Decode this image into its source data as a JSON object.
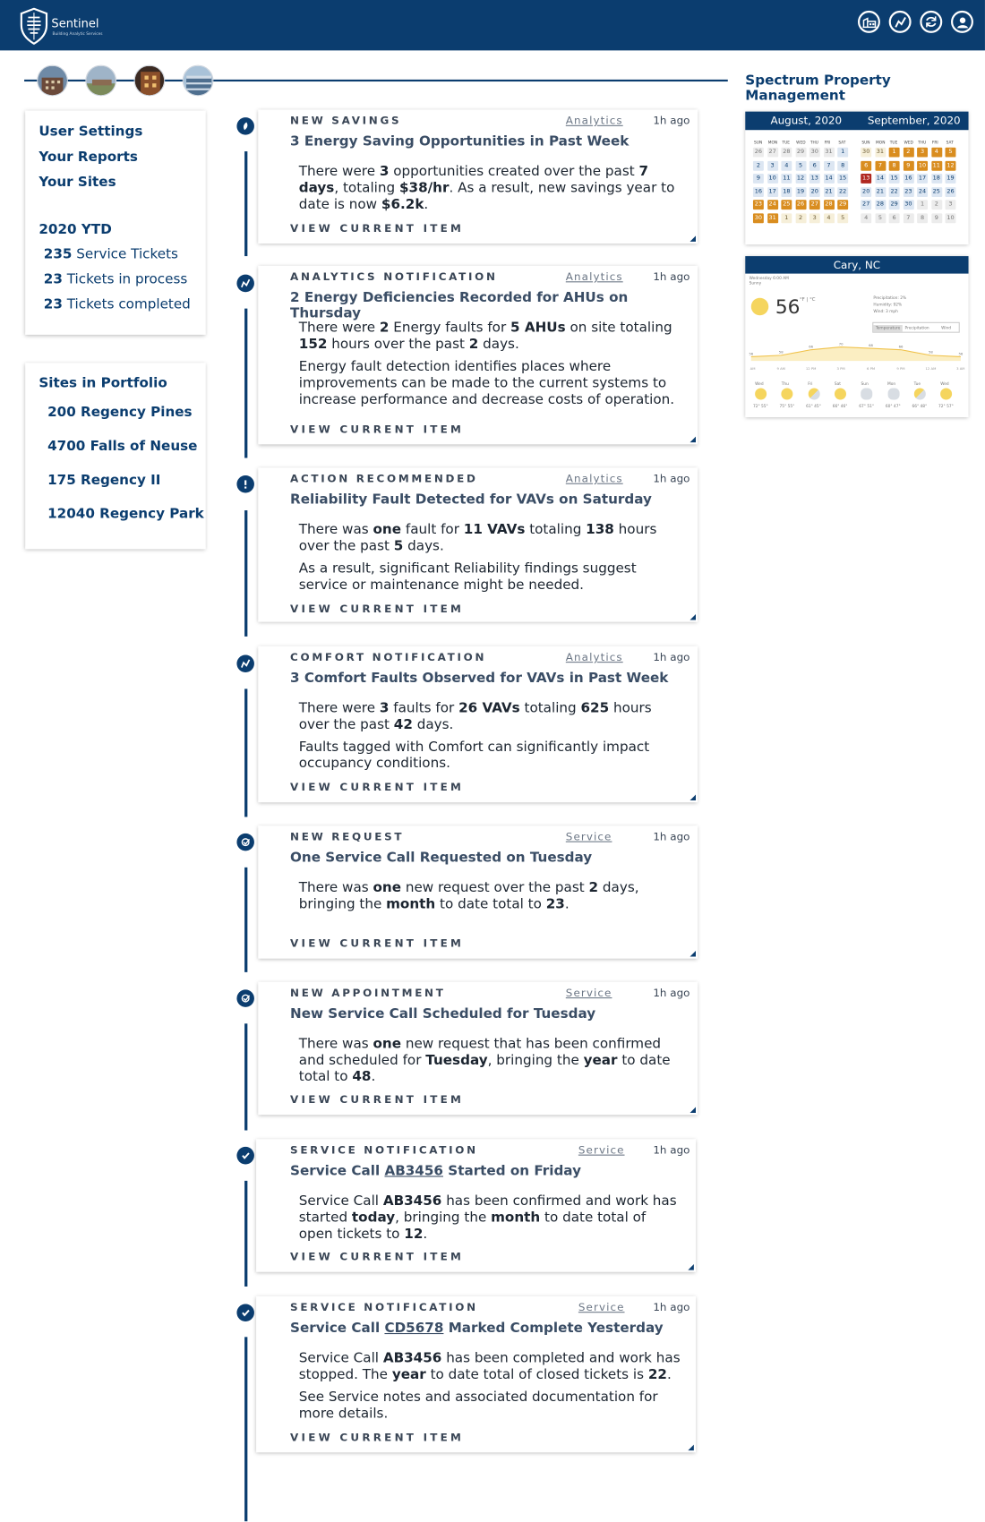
{
  "app": {
    "brand": "Sentinel",
    "tagline": "Building Analytic Services",
    "company": "Spectrum Property Management"
  },
  "topbar_icons": [
    "building-icon",
    "energy-icon",
    "refresh-icon",
    "user-icon"
  ],
  "colors": {
    "primary": "#0b3d6f",
    "accent": "#d98d1f",
    "today": "#b0271f"
  },
  "sidebar": {
    "links": [
      "User Settings",
      "Your Reports",
      "Your Sites"
    ],
    "ytd_title": "2020 YTD",
    "stats": [
      {
        "value": "235",
        "label": "Service Tickets"
      },
      {
        "value": "23",
        "label": "Tickets in process"
      },
      {
        "value": "23",
        "label": "Tickets completed"
      }
    ],
    "portfolio_title": "Sites in Portfolio",
    "sites": [
      "200 Regency Pines",
      "4700 Falls of Neuse",
      "175 Regency II",
      "12040 Regency Park"
    ]
  },
  "feed": [
    {
      "category": "NEW SAVINGS",
      "source": "Analytics",
      "time": "1h ago",
      "title": "3 Energy Saving Opportunities in Past Week",
      "icon": "savings-icon",
      "view": "VIEW CURRENT ITEM"
    },
    {
      "category": "ANALYTICS NOTIFICATION",
      "source": "Analytics",
      "time": "1h ago",
      "title": "2 Energy Deficiencies Recorded for AHUs on Thursday",
      "icon": "analytics-icon",
      "view": "VIEW CURRENT ITEM"
    },
    {
      "category": "ACTION RECOMMENDED",
      "source": "Analytics",
      "time": "1h ago",
      "title": "Reliability Fault Detected for VAVs on Saturday",
      "icon": "alert-icon",
      "view": "VIEW CURRENT ITEM"
    },
    {
      "category": "COMFORT NOTIFICATION",
      "source": "Analytics",
      "time": "1h ago",
      "title": "3 Comfort Faults Observed for VAVs in Past Week",
      "icon": "analytics-icon",
      "view": "VIEW CURRENT ITEM"
    },
    {
      "category": "NEW REQUEST",
      "source": "Service",
      "time": "1h ago",
      "title": "One Service Call Requested on Tuesday",
      "icon": "request-icon",
      "view": "VIEW CURRENT ITEM"
    },
    {
      "category": "NEW APPOINTMENT",
      "source": "Service",
      "time": "1h ago",
      "title": "New Service Call Scheduled for Tuesday",
      "icon": "request-icon",
      "view": "VIEW CURRENT ITEM"
    },
    {
      "category": "SERVICE NOTIFICATION",
      "source": "Service",
      "time": "1h ago",
      "title_pre": "Service Call",
      "title_code": "AB3456",
      "title_post": "Started on Friday",
      "icon": "check-icon",
      "view": "VIEW CURRENT ITEM"
    },
    {
      "category": "SERVICE NOTIFICATION",
      "source": "Service",
      "time": "1h ago",
      "title_pre": "Service Call",
      "title_code": "CD5678",
      "title_post": "Marked Complete Yesterday",
      "icon": "check-icon",
      "view": "VIEW CURRENT ITEM"
    }
  ],
  "feed_body": {
    "f0_a": "There were ",
    "f0_b": "3",
    "f0_c": " opportunities created over the past ",
    "f0_d": "7 days",
    "f0_e": ", totaling ",
    "f0_f": "$38/hr",
    "f0_g": ". As a result, new savings year to date is now ",
    "f0_h": "$6.2k",
    "f0_i": ".",
    "f1_a": "There were ",
    "f1_b": "2",
    "f1_c": " Energy faults for ",
    "f1_d": "5 AHUs",
    "f1_e": " on site totaling ",
    "f1_f": "152",
    "f1_g": " hours over the past ",
    "f1_h": "2",
    "f1_i": " days.",
    "f1_p2": "Energy fault detection identifies places where improvements can be made to the current systems to increase performance and decrease costs of operation.",
    "f2_a": "There was ",
    "f2_b": "one",
    "f2_c": " fault for ",
    "f2_d": "11 VAVs",
    "f2_e": " totaling ",
    "f2_f": "138",
    "f2_g": " hours over the past ",
    "f2_h": "5",
    "f2_i": " days.",
    "f2_p2": "As a result, significant Reliability findings suggest service or maintenance might be needed.",
    "f3_a": "There were ",
    "f3_b": "3",
    "f3_c": " faults for ",
    "f3_d": "26 VAVs",
    "f3_e": " totaling ",
    "f3_f": "625",
    "f3_g": " hours over the past ",
    "f3_h": "42",
    "f3_i": " days.",
    "f3_p2": "Faults tagged with Comfort can significantly impact occupancy conditions.",
    "f4_a": "There was ",
    "f4_b": "one",
    "f4_c": " new request over the past ",
    "f4_d": "2",
    "f4_e": " days, bringing the ",
    "f4_f": "month",
    "f4_g": " to date total to ",
    "f4_h": "23",
    "f4_i": ".",
    "f5_a": "There was ",
    "f5_b": "one",
    "f5_c": " new request that has been confirmed and scheduled for ",
    "f5_d": "Tuesday",
    "f5_e": ", bringing the ",
    "f5_f": "year",
    "f5_g": " to date total to ",
    "f5_h": "48",
    "f5_i": ".",
    "f6_a": "Service Call ",
    "f6_b": "AB3456",
    "f6_c": " has been confirmed and work has started ",
    "f6_d": "today",
    "f6_e": ", bringing the ",
    "f6_f": "month",
    "f6_g": " to date total of open tickets to ",
    "f6_h": "12",
    "f6_i": ".",
    "f7_a": "Service Call ",
    "f7_b": "AB3456",
    "f7_c": " has been completed and work has stopped. The ",
    "f7_d": "year",
    "f7_e": " to date total of closed tickets is ",
    "f7_f": "22",
    "f7_g": ".",
    "f7_p2": "See Service notes and associated documentation for more details."
  },
  "calendar": {
    "months": [
      "August, 2020",
      "September, 2020"
    ],
    "dow": [
      "SUN",
      "MON",
      "TUE",
      "WED",
      "THU",
      "FRI",
      "SAT"
    ],
    "aug": [
      [
        "26",
        "27",
        "28",
        "29",
        "30",
        "31",
        "1"
      ],
      [
        "2",
        "3",
        "4",
        "5",
        "6",
        "7",
        "8"
      ],
      [
        "9",
        "10",
        "11",
        "12",
        "13",
        "14",
        "15"
      ],
      [
        "16",
        "17",
        "18",
        "19",
        "20",
        "21",
        "22"
      ],
      [
        "23",
        "24",
        "25",
        "26",
        "27",
        "28",
        "29"
      ],
      [
        "30",
        "31",
        "1",
        "2",
        "3",
        "4",
        "5"
      ]
    ],
    "sep": [
      [
        "30",
        "31",
        "1",
        "2",
        "3",
        "4",
        "5"
      ],
      [
        "6",
        "7",
        "8",
        "9",
        "10",
        "11",
        "12"
      ],
      [
        "13",
        "14",
        "15",
        "16",
        "17",
        "18",
        "19"
      ],
      [
        "20",
        "21",
        "22",
        "23",
        "24",
        "25",
        "26"
      ],
      [
        "27",
        "28",
        "29",
        "30",
        "1",
        "2",
        "3"
      ],
      [
        "4",
        "5",
        "6",
        "7",
        "8",
        "9",
        "10"
      ]
    ]
  },
  "weather": {
    "city": "Cary, NC",
    "datetime": "Wednesday 6:00 AM",
    "condition": "Sunny",
    "temp": "56",
    "units": "°F | °C",
    "precip": "Precipitation: 2%",
    "humidity": "Humidity: 92%",
    "wind": "Wind: 3 mph",
    "tabs": [
      "Temperature",
      "Precipitation",
      "Wind"
    ],
    "hourly_temps": [
      "56",
      "58",
      "66",
      "70",
      "68",
      "66",
      "58",
      "56"
    ],
    "hours": [
      "6 AM",
      "9 AM",
      "12 PM",
      "3 PM",
      "6 PM",
      "9 PM",
      "12 AM",
      "3 AM"
    ],
    "days": [
      {
        "day": "Wed",
        "hi_lo": "72° 55°",
        "icon": "sun-icon"
      },
      {
        "day": "Thu",
        "hi_lo": "75° 55°",
        "icon": "sun-icon"
      },
      {
        "day": "Fri",
        "hi_lo": "61° 45°",
        "icon": "partly-cloudy-icon"
      },
      {
        "day": "Sat",
        "hi_lo": "66° 46°",
        "icon": "sun-icon"
      },
      {
        "day": "Sun",
        "hi_lo": "67° 51°",
        "icon": "rain-icon"
      },
      {
        "day": "Mon",
        "hi_lo": "60° 47°",
        "icon": "rain-icon"
      },
      {
        "day": "Tue",
        "hi_lo": "66° 48°",
        "icon": "partly-cloudy-icon"
      },
      {
        "day": "Wed",
        "hi_lo": "72° 57°",
        "icon": "sun-icon"
      }
    ]
  }
}
